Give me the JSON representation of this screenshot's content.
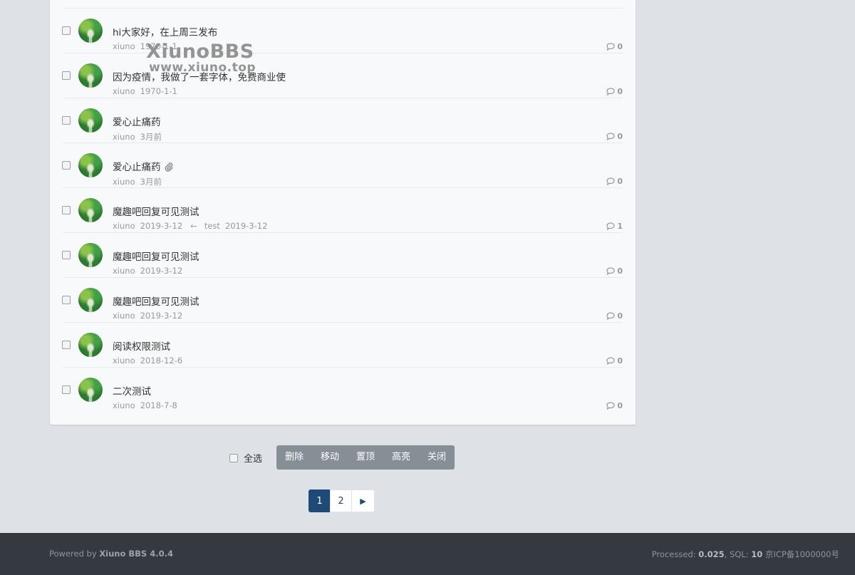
{
  "threads": [
    {
      "subject": "hi大家好，在上周三发布",
      "author": "xiuno",
      "date": "1970-1-1",
      "replies": "0"
    },
    {
      "subject": "因为疫情，我做了一套字体，免费商业使",
      "author": "xiuno",
      "date": "1970-1-1",
      "replies": "0"
    },
    {
      "subject": "爱心止痛药",
      "author": "xiuno",
      "date": "3月前",
      "replies": "0"
    },
    {
      "subject": "爱心止痛药",
      "author": "xiuno",
      "date": "3月前",
      "replies": "0",
      "attachment_icon": "paperclip-icon"
    },
    {
      "subject": "魔趣吧回复可见测试",
      "author": "xiuno",
      "date": "2019-3-12",
      "replies": "1",
      "last_reply_arrow": "←",
      "last_reply_user": "test",
      "last_reply_date": "2019-3-12"
    },
    {
      "subject": "魔趣吧回复可见测试",
      "author": "xiuno",
      "date": "2019-3-12",
      "replies": "0"
    },
    {
      "subject": "魔趣吧回复可见测试",
      "author": "xiuno",
      "date": "2019-3-12",
      "replies": "0"
    },
    {
      "subject": "阅读权限测试",
      "author": "xiuno",
      "date": "2018-12-6",
      "replies": "0"
    },
    {
      "subject": "二次测试",
      "author": "xiuno",
      "date": "2018-7-8",
      "replies": "0"
    }
  ],
  "watermark": {
    "title": "XiunoBBS",
    "subtitle": "www.xiuno.top"
  },
  "moderation": {
    "select_all_label": "全选",
    "buttons": [
      "删除",
      "移动",
      "置顶",
      "高亮",
      "关闭"
    ],
    "toolbar_color": "#868e96"
  },
  "pagination": {
    "pages": [
      "1",
      "2"
    ],
    "current": "1",
    "next_symbol": "▶",
    "active_color": "#1e4a78"
  },
  "footer": {
    "powered_prefix": "Powered by ",
    "powered_name": "Xiuno BBS 4.0.4",
    "processed_label": "Processed: ",
    "processed_value": "0.025",
    "sql_label": ", SQL: ",
    "sql_value": "10",
    "icp": " 京ICP备1000000号"
  }
}
